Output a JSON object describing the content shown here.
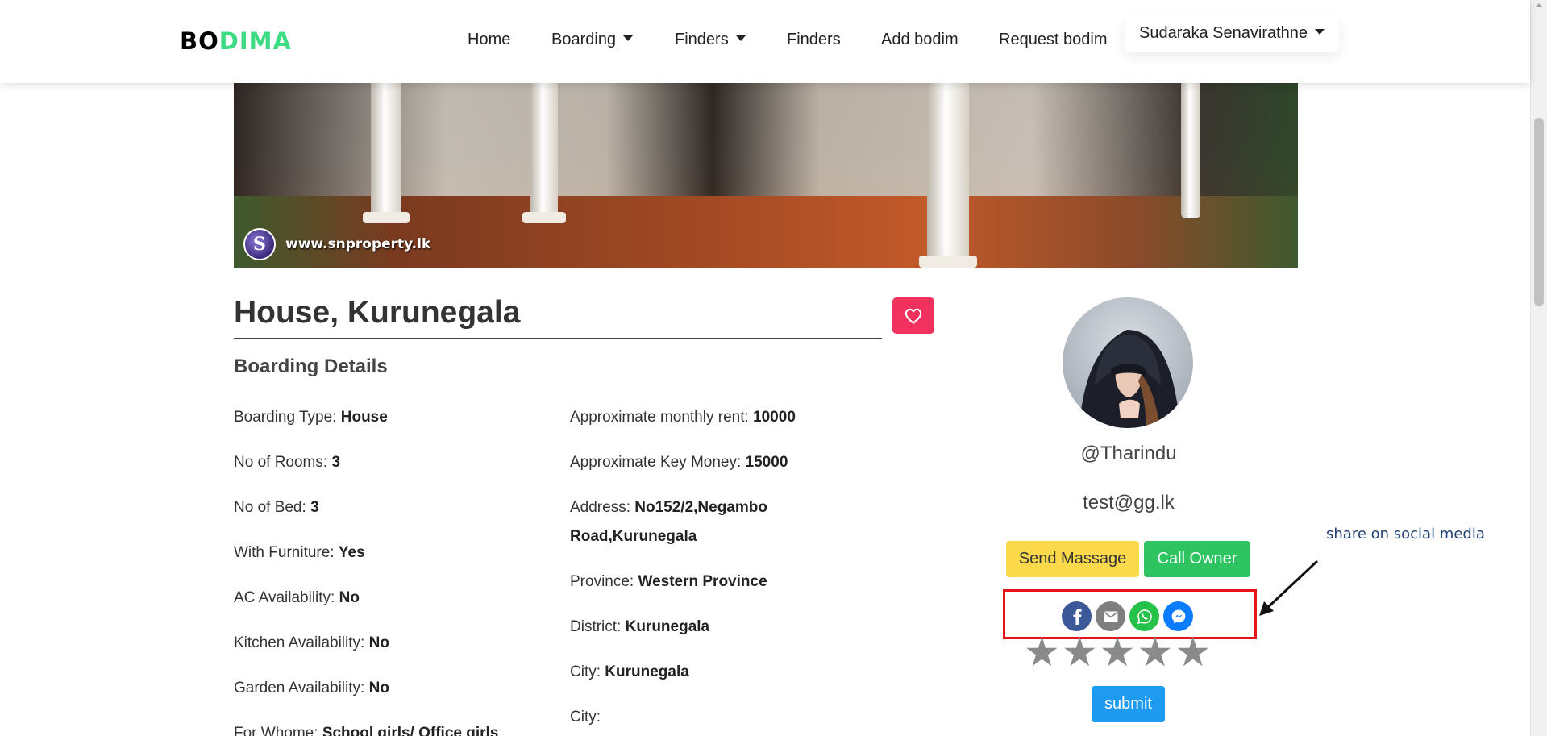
{
  "brand": {
    "part1": "BO",
    "part2": "DIMA"
  },
  "nav": {
    "home": "Home",
    "boarding": "Boarding",
    "finders_dropdown": "Finders",
    "finders": "Finders",
    "add": "Add bodim",
    "request": "Request bodim",
    "user": "Sudaraka Senavirathne"
  },
  "hero": {
    "watermark_logo": "S",
    "watermark_text": "www.snproperty.lk"
  },
  "listing": {
    "title": "House, Kurunegala",
    "section": "Boarding Details",
    "left": [
      {
        "label": "Boarding Type:",
        "value": "House"
      },
      {
        "label": "No of Rooms:",
        "value": "3"
      },
      {
        "label": "No of Bed:",
        "value": "3"
      },
      {
        "label": "With Furniture:",
        "value": "Yes"
      },
      {
        "label": "AC Availability:",
        "value": "No"
      },
      {
        "label": "Kitchen Availability:",
        "value": "No"
      },
      {
        "label": "Garden Availability:",
        "value": "No"
      },
      {
        "label": "For Whome:",
        "value": "School girls/ Office girls"
      }
    ],
    "right": [
      {
        "label": "Approximate monthly rent:",
        "value": "10000"
      },
      {
        "label": "Approximate Key Money:",
        "value": "15000"
      },
      {
        "label": "Address:",
        "value": "No152/2,Negambo"
      },
      {
        "label": "",
        "value": "Road,Kurunegala"
      },
      {
        "label": "Province:",
        "value": "Western Province"
      },
      {
        "label": "District:",
        "value": "Kurunegala"
      },
      {
        "label": "City:",
        "value": "Kurunegala"
      },
      {
        "label": "City:",
        "value": ""
      }
    ]
  },
  "owner": {
    "username": "@Tharindu",
    "email": "test@gg.lk",
    "send_label": "Send Massage",
    "call_label": "Call Owner",
    "submit_label": "submit",
    "stars": [
      "★",
      "★",
      "★",
      "★",
      "★"
    ]
  },
  "annotation": {
    "label": "share on social media"
  },
  "colors": {
    "brand_accent": "#3ddc84",
    "favorite": "#f2315f",
    "send": "#fcd94a",
    "call": "#2fc462",
    "submit": "#1e9bf0",
    "facebook": "#3b5998",
    "email": "#7f7f7f",
    "whatsapp": "#25c24a",
    "messenger": "#0a7cff",
    "highlight_box": "#e8141c"
  },
  "icons": [
    "heart-icon",
    "facebook-icon",
    "email-icon",
    "whatsapp-icon",
    "messenger-icon",
    "arrow-icon"
  ]
}
